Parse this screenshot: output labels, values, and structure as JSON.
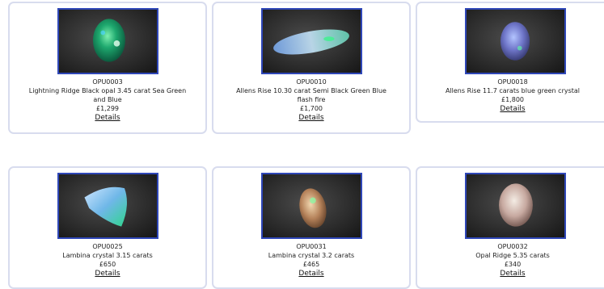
{
  "products": [
    {
      "code": "OPU0003",
      "description": "Lightning Ridge Black opal 3.45 carat Sea Green and Blue",
      "price": "£1,299",
      "link": "Details",
      "image": "opal-photo-green-oval"
    },
    {
      "code": "OPU0010",
      "description": "Allens Rise 10.30 carat Semi Black Green Blue flash fire",
      "price": "£1,700",
      "link": "Details",
      "image": "opal-photo-long-marquise"
    },
    {
      "code": "OPU0018",
      "description": "Allens Rise 11.7 carats blue green crystal",
      "price": "£1,800",
      "link": "Details",
      "image": "opal-photo-blue-oval"
    },
    {
      "code": "OPU0025",
      "description": "Lambina crystal 3.15 carats",
      "price": "£650",
      "link": "Details",
      "image": "opal-photo-triangle"
    },
    {
      "code": "OPU0031",
      "description": "Lambina crystal 3.2 carats",
      "price": "£465",
      "link": "Details",
      "image": "opal-photo-amber-oval"
    },
    {
      "code": "OPU0032",
      "description": "Opal Ridge 5.35 carats",
      "price": "£340",
      "link": "Details",
      "image": "opal-photo-milky-oval"
    }
  ]
}
